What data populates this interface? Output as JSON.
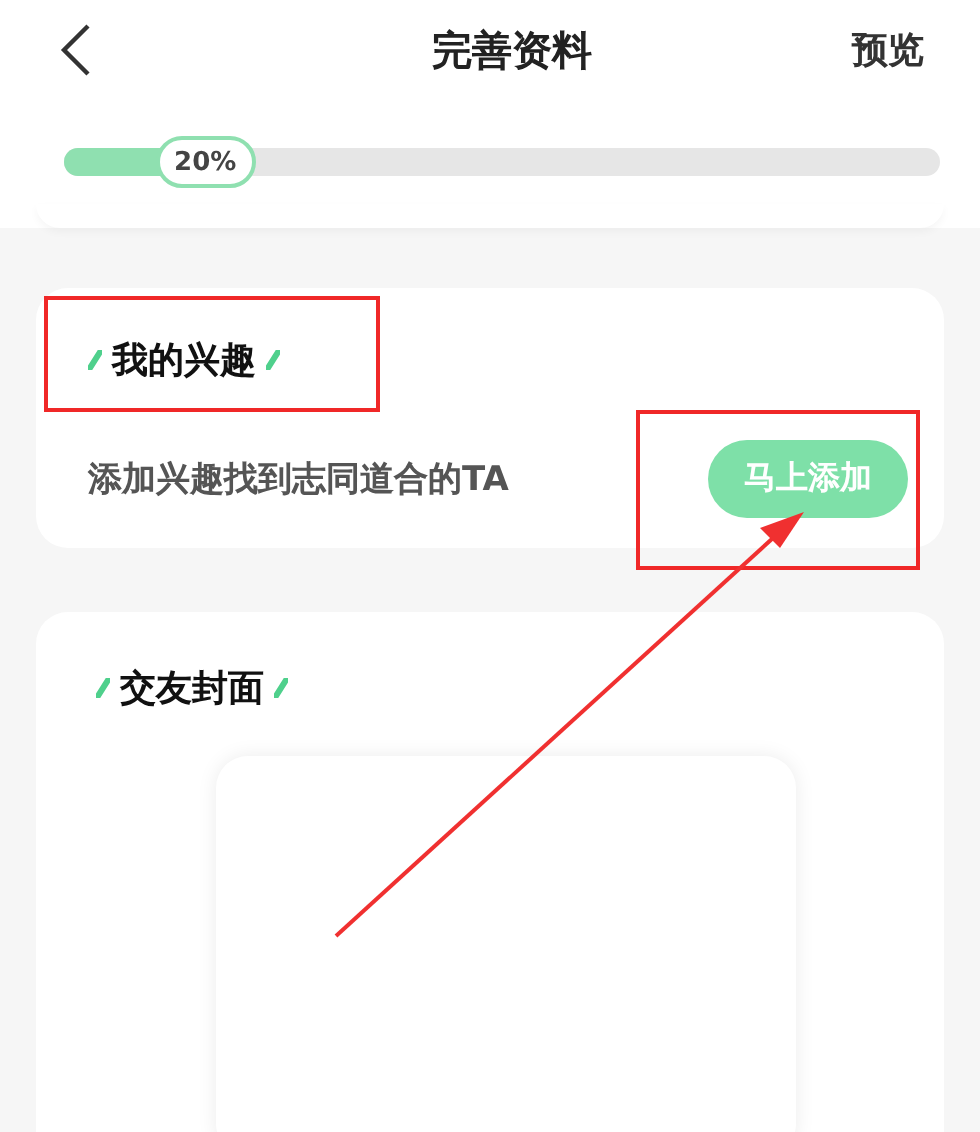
{
  "header": {
    "title": "完善资料",
    "action": "预览"
  },
  "progress": {
    "level": 0.2,
    "label": "20%"
  },
  "interest_card": {
    "title": "我的兴趣",
    "text": "添加兴趣找到志同道合的TA",
    "button": "马上添加"
  },
  "cover_card": {
    "title": "交友封面"
  }
}
